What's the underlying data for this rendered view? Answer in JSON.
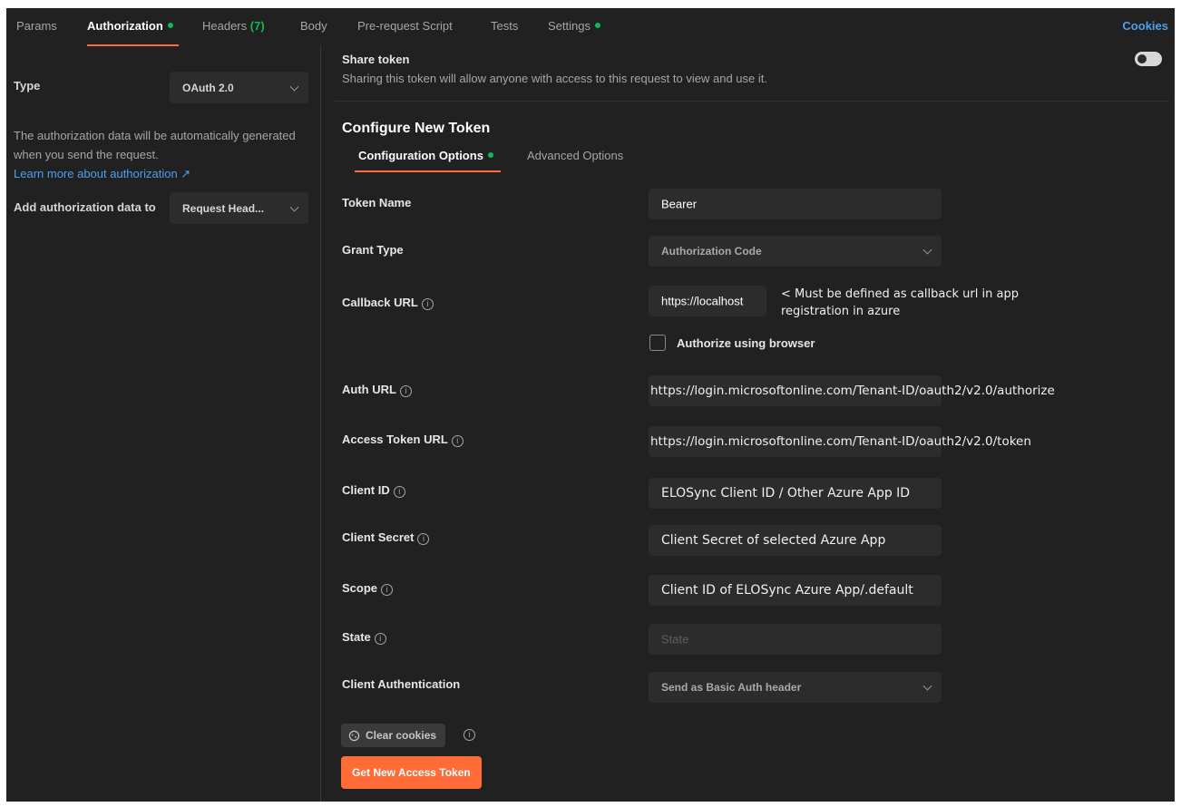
{
  "tabs": {
    "params": "Params",
    "authorization": "Authorization",
    "headers": "Headers",
    "headers_count": "(7)",
    "body": "Body",
    "prerequest": "Pre-request Script",
    "tests": "Tests",
    "settings": "Settings",
    "cookies": "Cookies"
  },
  "sidebar": {
    "type_label": "Type",
    "type_value": "OAuth 2.0",
    "description": "The authorization data will be automatically generated when you send the request.",
    "learn_more": "Learn more about authorization ↗",
    "add_to_label": "Add authorization data to",
    "add_to_value": "Request Head..."
  },
  "share": {
    "title": "Share token",
    "description": "Sharing this token will allow anyone with access to this request to view and use it."
  },
  "configure": {
    "title": "Configure New Token",
    "tab_config": "Configuration Options",
    "tab_advanced": "Advanced Options"
  },
  "form": {
    "token_name_label": "Token Name",
    "token_name_value": "Bearer",
    "grant_type_label": "Grant Type",
    "grant_type_value": "Authorization Code",
    "callback_label": "Callback URL",
    "callback_value": "https://localhost",
    "callback_note": "< Must be defined as callback url in app registration in azure",
    "authorize_browser_label": "Authorize using browser",
    "auth_url_label": "Auth URL",
    "auth_url_value": "https://login.microsoftonline.com/Tenant-ID/oauth2/v2.0/authorize",
    "access_token_url_label": "Access Token URL",
    "access_token_url_value": "https://login.microsoftonline.com/Tenant-ID/oauth2/v2.0/token",
    "client_id_label": "Client ID",
    "client_id_value": "ELOSync Client ID / Other Azure App ID",
    "client_secret_label": "Client Secret",
    "client_secret_value": "Client Secret of selected Azure App",
    "scope_label": "Scope",
    "scope_value": "Client ID of ELOSync Azure App/.default",
    "state_label": "State",
    "state_placeholder": "State",
    "client_auth_label": "Client Authentication",
    "client_auth_value": "Send as Basic Auth header"
  },
  "buttons": {
    "clear_cookies": "Clear cookies",
    "get_token": "Get New Access Token"
  },
  "colors": {
    "accent": "#ff6c37",
    "status_dot": "#0cbb52",
    "link": "#4d9ff0",
    "background": "#212121"
  }
}
